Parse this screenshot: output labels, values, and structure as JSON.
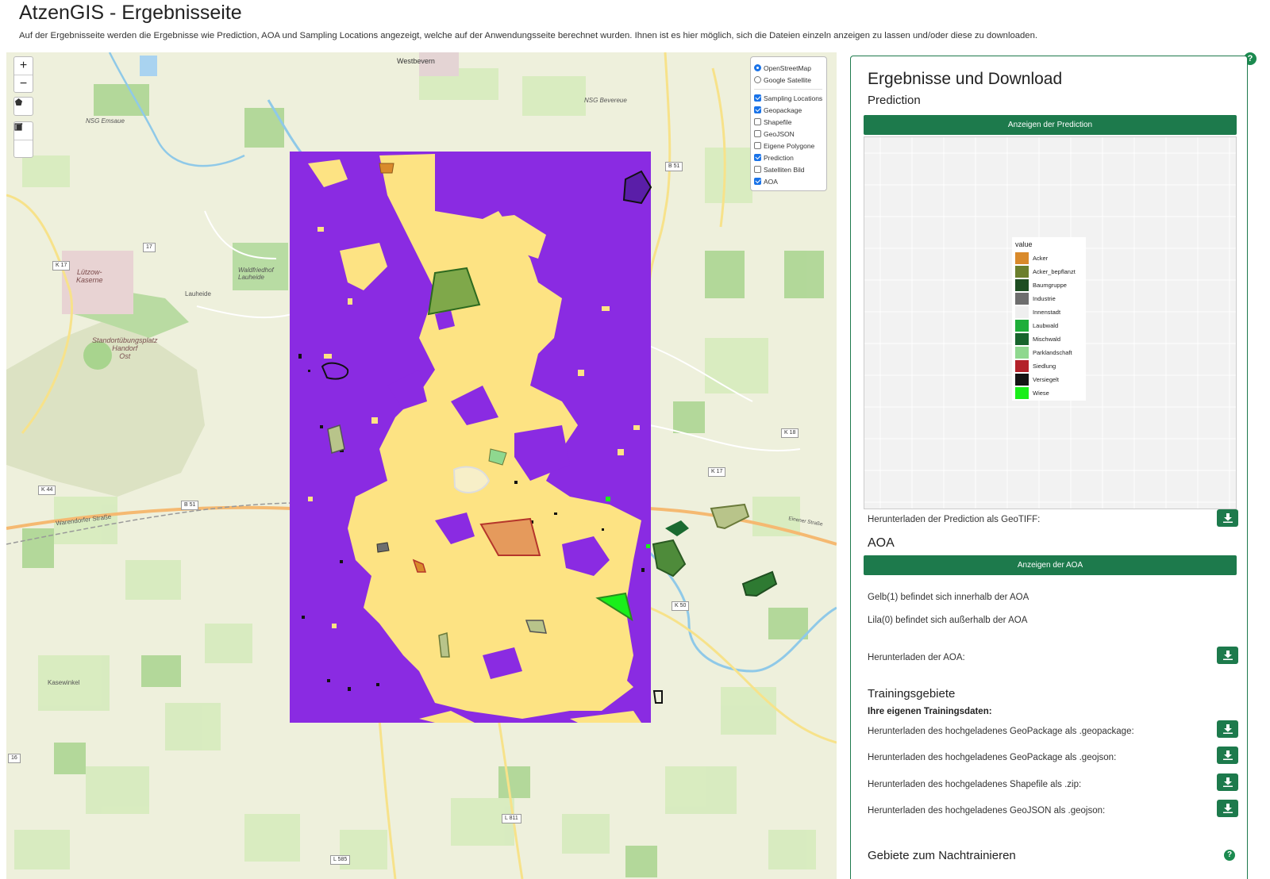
{
  "page": {
    "title": "AtzenGIS - Ergebnisseite",
    "description": "Auf der Ergebnisseite werden die Ergebnisse wie Prediction, AOA und Sampling Locations angezeigt, welche auf der Anwendungsseite berechnet wurden. Ihnen ist es hier möglich, sich die Dateien einzeln anzeigen zu lassen und/oder diese zu downloaden."
  },
  "map": {
    "zoom_in": "+",
    "zoom_out": "−",
    "layers": {
      "base": [
        {
          "label": "OpenStreetMap",
          "checked": true
        },
        {
          "label": "Google Satellite",
          "checked": false
        }
      ],
      "overlays": [
        {
          "label": "Sampling Locations",
          "checked": true
        },
        {
          "label": "Geopackage",
          "checked": true
        },
        {
          "label": "Shapefile",
          "checked": false
        },
        {
          "label": "GeoJSON",
          "checked": false
        },
        {
          "label": "Eigene Polygone",
          "checked": false
        },
        {
          "label": "Prediction",
          "checked": true
        },
        {
          "label": "Satelliten Bild",
          "checked": false
        },
        {
          "label": "AOA",
          "checked": true
        }
      ]
    },
    "labels": {
      "westbevern": "Westbevern",
      "lutzow": "Lützow-\nKaserne",
      "standort": "Standortübungsplatz\nHandorf\nOst",
      "waldfriedhof": "Waldfriedhof\nLauheide",
      "lauheide": "Lauheide",
      "kasewinkel": "Kasewinkel",
      "nsg_emsaue": "NSG Emsaue",
      "nsg_bevereue": "NSG Bevereue",
      "warendorfer": "Warendorfer Straße",
      "einener": "Einener Straße"
    },
    "road_tags": [
      "K 17",
      "B 51",
      "K 44",
      "B 51",
      "K 18",
      "K 17",
      "K 50",
      "L 811",
      "L 585",
      "16",
      "17"
    ],
    "colors": {
      "aoa_inside": "#fde383",
      "aoa_outside": "#8a2be2"
    }
  },
  "panel": {
    "title": "Ergebnisse und Download",
    "prediction": {
      "heading": "Prediction",
      "show_button": "Anzeigen der Prediction",
      "download_label": "Herunterladen der Prediction als GeoTIFF:"
    },
    "legend": {
      "title": "value",
      "items": [
        {
          "label": "Acker",
          "color": "#d98a2b"
        },
        {
          "label": "Acker_bepflanzt",
          "color": "#6b7f2d"
        },
        {
          "label": "Baumgruppe",
          "color": "#1e4d22"
        },
        {
          "label": "Industrie",
          "color": "#6e6e6e"
        },
        {
          "label": "Innenstadt",
          "color": "#efefef"
        },
        {
          "label": "Laubwald",
          "color": "#1fae3a"
        },
        {
          "label": "Mischwald",
          "color": "#17642c"
        },
        {
          "label": "Parklandschaft",
          "color": "#8fd88f"
        },
        {
          "label": "Siedlung",
          "color": "#b3222a"
        },
        {
          "label": "Versiegelt",
          "color": "#151515"
        },
        {
          "label": "Wiese",
          "color": "#1aee1a"
        }
      ]
    },
    "aoa": {
      "heading": "AOA",
      "show_button": "Anzeigen der AOA",
      "inside_text": "Gelb(1) befindet sich innerhalb der AOA",
      "outside_text": "Lila(0) befindet sich außerhalb der AOA",
      "download_label": "Herunterladen der AOA:"
    },
    "training": {
      "heading": "Trainingsgebiete",
      "subheading": "Ihre eigenen Trainingsdaten:",
      "downloads": [
        "Herunterladen des hochgeladenes GeoPackage als .geopackage:",
        "Herunterladen des hochgeladenes GeoPackage als .geojson:",
        "Herunterladen des hochgeladenes Shapefile als .zip:",
        "Herunterladen des hochgeladenes GeoJSON als .geojson:"
      ]
    },
    "retrain": {
      "heading": "Gebiete zum Nachtrainieren"
    },
    "help": "?"
  }
}
